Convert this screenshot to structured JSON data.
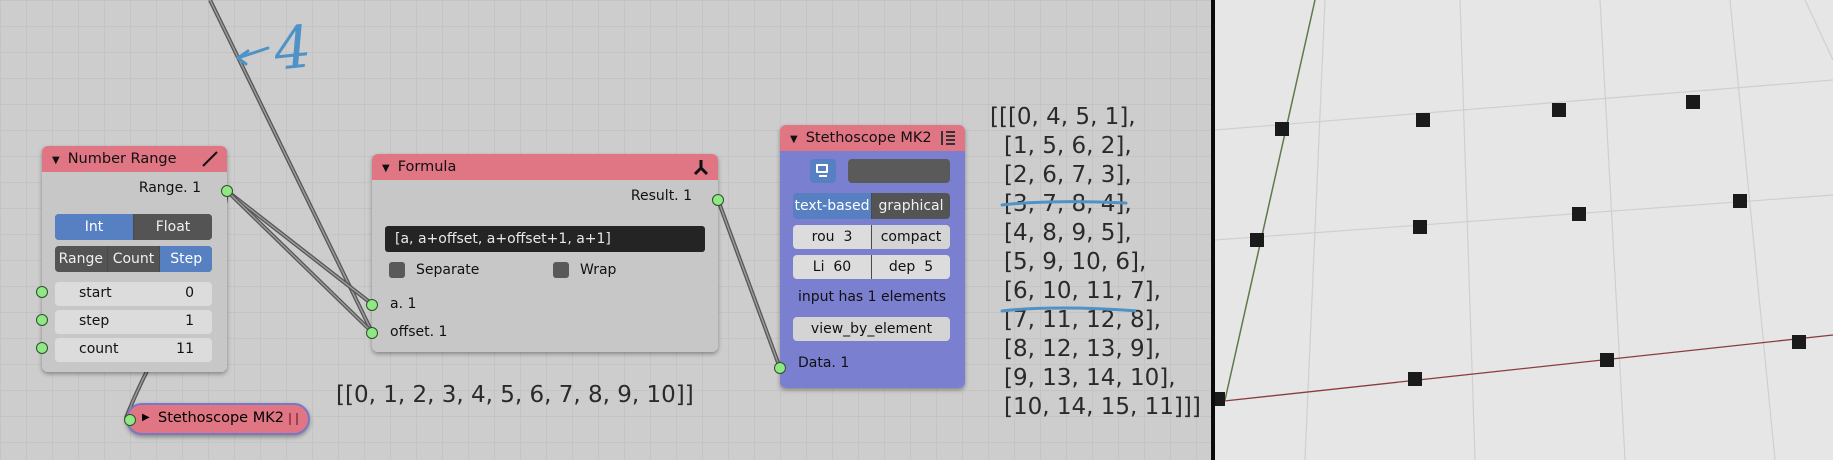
{
  "annotation": {
    "number": "4"
  },
  "number_range": {
    "title": "Number Range",
    "output_label": "Range. 1",
    "type_options": [
      "Int",
      "Float"
    ],
    "type_selected": "Int",
    "mode_options": [
      "Range",
      "Count",
      "Step"
    ],
    "mode_selected": "Step",
    "fields": [
      {
        "name": "start",
        "value": "0"
      },
      {
        "name": "step",
        "value": "1"
      },
      {
        "name": "count",
        "value": "11"
      }
    ]
  },
  "stethoscope_collapsed": {
    "title": "Stethoscope MK2"
  },
  "range_output_text": "[[0, 1, 2, 3, 4, 5, 6, 7, 8, 9, 10]]",
  "formula": {
    "title": "Formula",
    "output_label": "Result. 1",
    "expression": "[a, a+offset, a+offset+1, a+1]",
    "separate_label": "Separate",
    "wrap_label": "Wrap",
    "inputs": [
      "a. 1",
      "offset. 1"
    ]
  },
  "stethoscope": {
    "title": "Stethoscope MK2",
    "mode_options": [
      "text-based",
      "graphical"
    ],
    "mode_selected": "text-based",
    "rounding_label": "rou",
    "rounding_value": "3",
    "compact_label": "compact",
    "lines_label": "Li",
    "lines_value": "60",
    "depth_label": "dep",
    "depth_value": "5",
    "info": "input has 1 elements",
    "view_button": "view_by_element",
    "input_label": "Data. 1"
  },
  "output_lines": [
    "[[[0, 4, 5, 1],",
    "[1, 5, 6, 2],",
    "[2, 6, 7, 3],",
    "[3, 7, 8, 4],",
    "[4, 8, 9, 5],",
    "[5, 9, 10, 6],",
    "[6, 10, 11, 7],",
    "[7, 11, 12, 8],",
    "[8, 12, 13, 9],",
    "[9, 13, 14, 10],",
    "[10, 14, 15, 11]]]"
  ],
  "colors": {
    "node_header_red": "#e07584",
    "node_body_gray": "#c7c7c7",
    "stethoscope_body": "#7b7fd0",
    "active_blue": "#5680c2",
    "socket_green": "#8fe884",
    "annotation_blue": "#4f93c6"
  }
}
